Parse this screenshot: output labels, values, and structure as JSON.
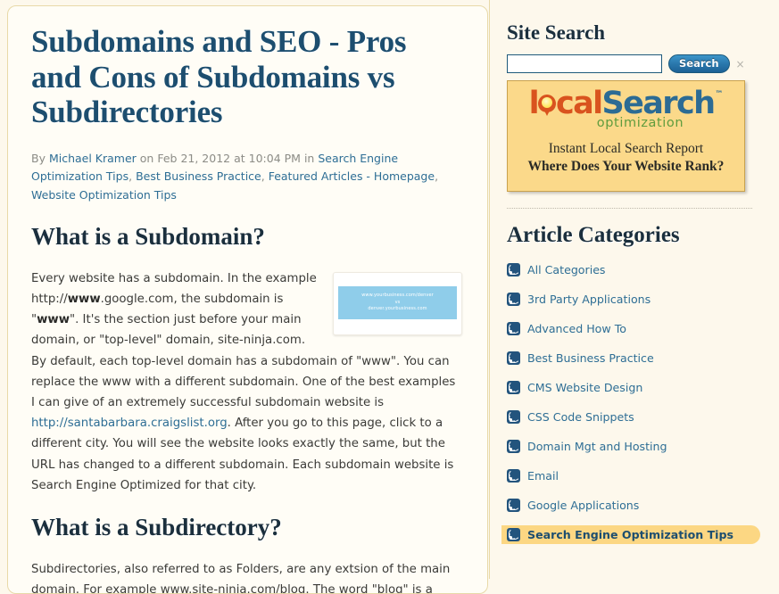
{
  "article": {
    "title": "Subdomains and SEO - Pros and Cons of Subdomains vs Subdirectories",
    "byline": {
      "by_label": "By ",
      "author": "Michael Kramer",
      "on_label": " on ",
      "date": "Feb 21, 2012",
      "at_label": " at ",
      "time": "10:04 PM",
      "in_label": " in ",
      "categories": [
        "Search Engine Optimization Tips",
        "Best Business Practice",
        "Featured Articles - Homepage",
        "Website Optimization Tips"
      ]
    },
    "section1": {
      "heading": "What is a Subdomain?",
      "para_part1": "Every website has a subdomain.  In the example http://",
      "bold1": "www",
      "para_part2": ".google.com, the subdomain is \"",
      "bold2": "www",
      "para_part3": "\".  It's the section just before your main domain, or \"top-level\" domain, site-ninja.com. By default, each top-level domain has a subdomain of \"www\".  You can replace the www with a different subdomain.  One of the best examples I can give of an extremely successful subdomain website is ",
      "link_text": "http://santabarbara.craigslist.org",
      "para_part4": ".  After you go to this page, click to a different city.  You will see the website looks exactly the same, but the URL has changed to a different subdomain. Each subdomain website is Search Engine Optimized for that city."
    },
    "figure": {
      "line1": "www.yourbusiness.com/denver",
      "line2": "vs",
      "line3": "denver.yourbusiness.com"
    },
    "section2": {
      "heading": "What is a Subdirectory?",
      "para": "Subdirectories, also referred to as Folders, are any extsion of the main domain.  For example www.site-ninja.com/blog.  The word \"blog\" is a"
    }
  },
  "sidebar": {
    "search_widget": {
      "title": "Site Search",
      "input_value": "",
      "input_placeholder": "",
      "button_label": "Search",
      "close_label": "×"
    },
    "banner_ad": {
      "logo_local": "l",
      "logo_local_rest": "cal",
      "logo_search": "Search",
      "logo_tm": "™",
      "logo_sub": "optimization",
      "line1": "Instant Local Search Report",
      "line2": "Where Does Your Website Rank?"
    },
    "categories_widget": {
      "title": "Article Categories",
      "items": [
        {
          "label": "All Categories",
          "active": false
        },
        {
          "label": "3rd Party Applications",
          "active": false
        },
        {
          "label": "Advanced How To",
          "active": false
        },
        {
          "label": "Best Business Practice",
          "active": false
        },
        {
          "label": "CMS Website Design",
          "active": false
        },
        {
          "label": "CSS Code Snippets",
          "active": false
        },
        {
          "label": "Domain Mgt and Hosting",
          "active": false
        },
        {
          "label": "Email",
          "active": false
        },
        {
          "label": "Google Applications",
          "active": false
        },
        {
          "label": "Search Engine Optimization Tips",
          "active": true
        }
      ]
    }
  },
  "colors": {
    "page_background": "#fdf8ec",
    "card_background": "#fffdf6",
    "card_border": "#e8d9a8",
    "title_blue": "#1d4e6f",
    "link_blue": "#2e6e95",
    "body_text": "#3b3b38",
    "muted_text": "#8c8c86",
    "highlight_gold": "#fcd783",
    "ad_background": "#fbd98a",
    "logo_orange": "#d9531e",
    "logo_blue": "#2c6b94",
    "logo_green": "#5f9c3e",
    "rss_icon": "#23547d",
    "search_button": "#2b7aaf"
  }
}
